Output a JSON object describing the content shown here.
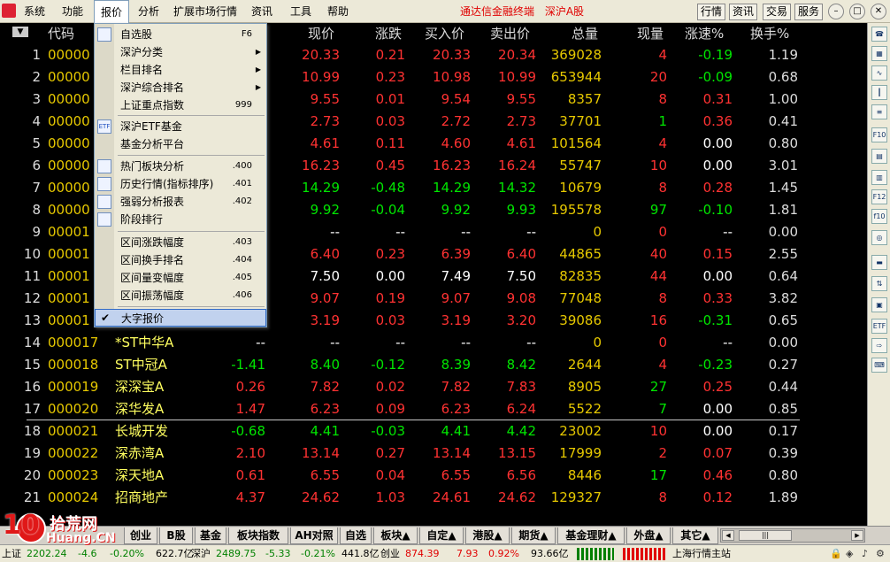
{
  "menubar": {
    "items": [
      "系统",
      "功能",
      "报价",
      "分析",
      "扩展市场行情",
      "资讯",
      "工具",
      "帮助"
    ],
    "brand": "通达信金融终端",
    "market": "深沪A股",
    "right_buttons": [
      "行情",
      "资讯",
      "交易",
      "服务"
    ]
  },
  "table": {
    "headers": [
      "代码",
      "现价",
      "涨跌",
      "买入价",
      "卖出价",
      "总量",
      "现量",
      "涨速%",
      "换手%"
    ],
    "sort_glyph": "▼",
    "rows": [
      {
        "n": "1",
        "code": "00000",
        "name": "",
        "chg": "",
        "price": "20.33",
        "diff": "0.21",
        "buy": "20.33",
        "sell": "20.34",
        "vol": "369028",
        "cur": "4",
        "spd": "-0.19",
        "turn": "1.19"
      },
      {
        "n": "2",
        "code": "00000",
        "name": "",
        "chg": "",
        "price": "10.99",
        "diff": "0.23",
        "buy": "10.98",
        "sell": "10.99",
        "vol": "653944",
        "cur": "20",
        "spd": "-0.09",
        "turn": "0.68"
      },
      {
        "n": "3",
        "code": "00000",
        "name": "",
        "chg": "",
        "price": "9.55",
        "diff": "0.01",
        "buy": "9.54",
        "sell": "9.55",
        "vol": "8357",
        "cur": "8",
        "spd": "0.31",
        "turn": "1.00"
      },
      {
        "n": "4",
        "code": "00000",
        "name": "",
        "chg": "",
        "price": "2.73",
        "diff": "0.03",
        "buy": "2.72",
        "sell": "2.73",
        "vol": "37701",
        "cur": "1",
        "spd": "0.36",
        "turn": "0.41"
      },
      {
        "n": "5",
        "code": "00000",
        "name": "",
        "chg": "",
        "price": "4.61",
        "diff": "0.11",
        "buy": "4.60",
        "sell": "4.61",
        "vol": "101564",
        "cur": "4",
        "spd": "0.00",
        "turn": "0.80"
      },
      {
        "n": "6",
        "code": "00000",
        "name": "",
        "chg": "",
        "price": "16.23",
        "diff": "0.45",
        "buy": "16.23",
        "sell": "16.24",
        "vol": "55747",
        "cur": "10",
        "spd": "0.00",
        "turn": "3.01"
      },
      {
        "n": "7",
        "code": "00000",
        "name": "",
        "chg": "",
        "price": "14.29",
        "diff": "-0.48",
        "buy": "14.29",
        "sell": "14.32",
        "vol": "10679",
        "cur": "8",
        "spd": "0.28",
        "turn": "1.45"
      },
      {
        "n": "8",
        "code": "00000",
        "name": "",
        "chg": "",
        "price": "9.92",
        "diff": "-0.04",
        "buy": "9.92",
        "sell": "9.93",
        "vol": "195578",
        "cur": "97",
        "spd": "-0.10",
        "turn": "1.81"
      },
      {
        "n": "9",
        "code": "00001",
        "name": "",
        "chg": "",
        "price": "--",
        "diff": "--",
        "buy": "--",
        "sell": "--",
        "vol": "0",
        "cur": "0",
        "spd": "--",
        "turn": "0.00"
      },
      {
        "n": "10",
        "code": "00001",
        "name": "",
        "chg": "",
        "price": "6.40",
        "diff": "0.23",
        "buy": "6.39",
        "sell": "6.40",
        "vol": "44865",
        "cur": "40",
        "spd": "0.15",
        "turn": "2.55"
      },
      {
        "n": "11",
        "code": "00001",
        "name": "",
        "chg": "",
        "price": "7.50",
        "diff": "0.00",
        "buy": "7.49",
        "sell": "7.50",
        "vol": "82835",
        "cur": "44",
        "spd": "0.00",
        "turn": "0.64"
      },
      {
        "n": "12",
        "code": "00001",
        "name": "",
        "chg": "",
        "price": "9.07",
        "diff": "0.19",
        "buy": "9.07",
        "sell": "9.08",
        "vol": "77048",
        "cur": "8",
        "spd": "0.33",
        "turn": "3.82"
      },
      {
        "n": "13",
        "code": "00001",
        "name": "",
        "chg": "",
        "price": "3.19",
        "diff": "0.03",
        "buy": "3.19",
        "sell": "3.20",
        "vol": "39086",
        "cur": "16",
        "spd": "-0.31",
        "turn": "0.65"
      },
      {
        "n": "14",
        "code": "000017",
        "name": "*ST中华A",
        "chg": "--",
        "price": "--",
        "diff": "--",
        "buy": "--",
        "sell": "--",
        "vol": "0",
        "cur": "0",
        "spd": "--",
        "turn": "0.00"
      },
      {
        "n": "15",
        "code": "000018",
        "name": "ST中冠A",
        "chg": "-1.41",
        "price": "8.40",
        "diff": "-0.12",
        "buy": "8.39",
        "sell": "8.42",
        "vol": "2644",
        "cur": "4",
        "spd": "-0.23",
        "turn": "0.27"
      },
      {
        "n": "16",
        "code": "000019",
        "name": "深深宝A",
        "chg": "0.26",
        "price": "7.82",
        "diff": "0.02",
        "buy": "7.82",
        "sell": "7.83",
        "vol": "8905",
        "cur": "27",
        "spd": "0.25",
        "turn": "0.44"
      },
      {
        "n": "17",
        "code": "000020",
        "name": "深华发A",
        "chg": "1.47",
        "price": "6.23",
        "diff": "0.09",
        "buy": "6.23",
        "sell": "6.24",
        "vol": "5522",
        "cur": "7",
        "spd": "0.00",
        "turn": "0.85"
      },
      {
        "n": "18",
        "code": "000021",
        "name": "长城开发",
        "chg": "-0.68",
        "price": "4.41",
        "diff": "-0.03",
        "buy": "4.41",
        "sell": "4.42",
        "vol": "23002",
        "cur": "10",
        "spd": "0.00",
        "turn": "0.17"
      },
      {
        "n": "19",
        "code": "000022",
        "name": "深赤湾A",
        "chg": "2.10",
        "price": "13.14",
        "diff": "0.27",
        "buy": "13.14",
        "sell": "13.15",
        "vol": "17999",
        "cur": "2",
        "spd": "0.07",
        "turn": "0.39"
      },
      {
        "n": "20",
        "code": "000023",
        "name": "深天地A",
        "chg": "0.61",
        "price": "6.55",
        "diff": "0.04",
        "buy": "6.55",
        "sell": "6.56",
        "vol": "8446",
        "cur": "17",
        "spd": "0.46",
        "turn": "0.80"
      },
      {
        "n": "21",
        "code": "000024",
        "name": "招商地产",
        "chg": "4.37",
        "price": "24.62",
        "diff": "1.03",
        "buy": "24.61",
        "sell": "24.62",
        "vol": "129327",
        "cur": "8",
        "spd": "0.12",
        "turn": "1.89"
      }
    ]
  },
  "colors": {
    "red": "#ff3232",
    "green": "#00e600",
    "white": "#ffffff",
    "yellow": "#ffff00",
    "vol": "#e6c800",
    "code": "#e6c800",
    "name": "#ffff60"
  },
  "dropdown": {
    "items": [
      {
        "label": "自选股",
        "shortcut": "F6",
        "icon": "list-icon",
        "submenu": false
      },
      {
        "label": "深沪分类",
        "shortcut": "",
        "submenu": true
      },
      {
        "label": "栏目排名",
        "shortcut": "",
        "submenu": true
      },
      {
        "label": "深沪综合排名",
        "shortcut": "",
        "submenu": true
      },
      {
        "label": "上证重点指数",
        "shortcut": "999",
        "submenu": false
      },
      {
        "label": "深沪ETF基金",
        "shortcut": "",
        "icon": "etf-icon",
        "submenu": false
      },
      {
        "label": "基金分析平台",
        "shortcut": "",
        "submenu": false
      },
      {
        "label": "热门板块分析",
        "shortcut": ".400",
        "icon": "board-icon",
        "submenu": false
      },
      {
        "label": "历史行情(指标排序)",
        "shortcut": ".401",
        "icon": "history-icon",
        "submenu": false
      },
      {
        "label": "强弱分析报表",
        "shortcut": ".402",
        "icon": "report-icon",
        "submenu": false
      },
      {
        "label": "阶段排行",
        "shortcut": "",
        "icon": "rank-icon",
        "submenu": false
      },
      {
        "label": "区间涨跌幅度",
        "shortcut": ".403",
        "submenu": false
      },
      {
        "label": "区间换手排名",
        "shortcut": ".404",
        "submenu": false
      },
      {
        "label": "区间量变幅度",
        "shortcut": ".405",
        "submenu": false
      },
      {
        "label": "区间振荡幅度",
        "shortcut": ".406",
        "submenu": false
      },
      {
        "label": "大字报价",
        "shortcut": "",
        "checked": true,
        "submenu": false
      }
    ],
    "check_glyph": "✔",
    "arrow_glyph": "▶",
    "etf_text": "ETF"
  },
  "tabs": [
    "创业",
    "B股",
    "基金",
    "板块指数",
    "AH对照",
    "自选",
    "板块▲",
    "自定▲",
    "港股▲",
    "期货▲",
    "基金理财▲",
    "外盘▲",
    "其它▲"
  ],
  "scroll": {
    "left": "◀",
    "right": "▶",
    "thumb": "|||"
  },
  "status": {
    "sh_label": "上证",
    "sh_val": "2202.24",
    "sh_chg": "-4.6",
    "sh_pct": "-0.20%",
    "sh_amt": "622.7亿",
    "sz_label": "深沪",
    "sz_val": "2489.75",
    "sz_chg": "-5.33",
    "sz_pct": "-0.21%",
    "sz_amt": "441.8亿",
    "cy_label": "创业",
    "cy_val": "874.39",
    "cy_chg": "7.93",
    "cy_pct": "0.92%",
    "cy_amt": "93.66亿",
    "station": "上海行情主站"
  },
  "watermark": {
    "digits": "10",
    "name": "拾荒网",
    "url": "Huang.CN"
  },
  "toolbar_icons": [
    "phone-icon",
    "grid-icon",
    "chart-icon",
    "kline-icon",
    "list-icon",
    "f10-icon",
    "notes-icon",
    "doc-icon",
    "f12-icon",
    "f10b-icon",
    "search-icon",
    "folder-icon",
    "updown-icon",
    "calc-icon",
    "etf-icon",
    "export-icon",
    "setting-icon"
  ],
  "toolbar_glyphs": [
    "☎",
    "▦",
    "∿",
    "┃",
    "≡",
    "F10",
    "▤",
    "▥",
    "F12",
    "f10",
    "◎",
    "▬",
    "⇅",
    "▣",
    "ETF",
    "⇨",
    "⌨"
  ]
}
